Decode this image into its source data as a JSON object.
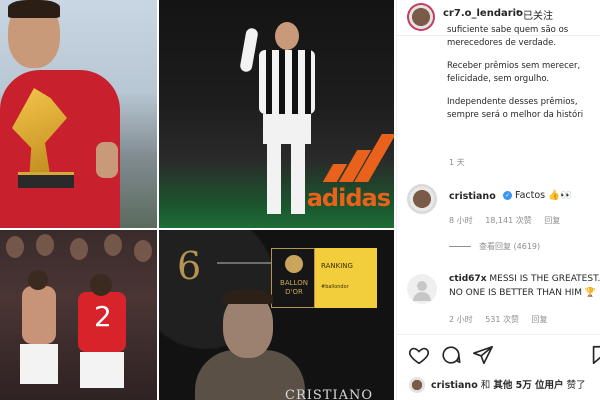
{
  "header": {
    "username": "cr7.o_lendario",
    "separator": "•",
    "follow_status": "已关注"
  },
  "media": {
    "tile2_brand": "adidas",
    "tile3_jersey_number": "2",
    "tile4_rank": "6",
    "tile4_badge": "BALLON D'OR",
    "tile4_ranking_label": "RANKING",
    "tile4_hashtag": "#ballondor",
    "tile4_name": "CRISTIANO"
  },
  "caption": {
    "lines_a": [
      "suficiente sabe quem são os",
      "merecedores de verdade."
    ],
    "lines_b": [
      "Receber prêmios sem merecer,",
      "felicidade, sem orgulho."
    ],
    "lines_c": [
      "Independente desses prêmios,",
      "sempre será o melhor da históri"
    ],
    "time": "1 天"
  },
  "comments": [
    {
      "username": "cristiano",
      "verified": true,
      "text": "Factos 👍👀",
      "time": "8 小时",
      "likes": "18,141 次赞",
      "reply": "回复",
      "view_replies": "查看回复 (4619)"
    },
    {
      "username": "ctid67x",
      "text": "MESSI IS THE GREATEST. NO ONE IS BETTER THAN HIM 🏆",
      "time": "2 小时",
      "likes": "531 次赞",
      "reply": "回复"
    }
  ],
  "actions": {
    "like": "heart-icon",
    "comment": "comment-icon",
    "share": "send-icon",
    "save": "bookmark-icon"
  },
  "likes_summary": {
    "user": "cristiano",
    "connector": "和",
    "others": "其他 5万 位用户",
    "suffix": "赞了"
  },
  "colors": {
    "accent_blue": "#3897f0",
    "text": "#262626",
    "muted": "#8e8e8e",
    "adidas_orange": "#e8621c",
    "ballon_gold": "#c9a65c",
    "ranking_yellow": "#f2cd3c"
  }
}
